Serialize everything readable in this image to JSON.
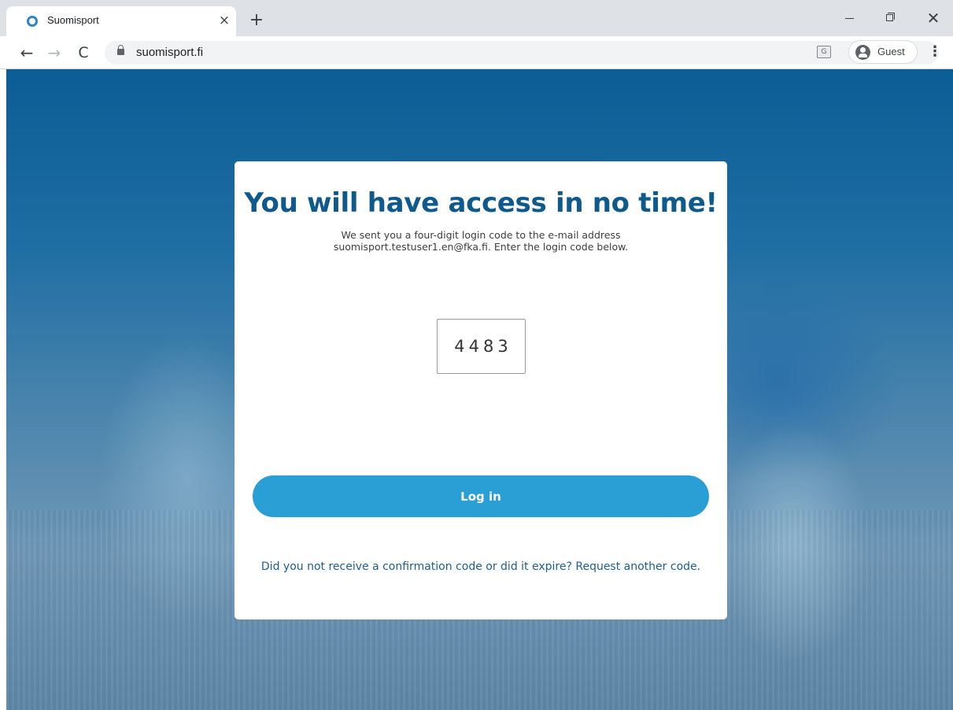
{
  "browser": {
    "tab": {
      "title": "Suomisport",
      "close_glyph": "×"
    },
    "new_tab_glyph": "+",
    "window_controls": {
      "close_glyph": "✕"
    },
    "nav": {
      "back_glyph": "←",
      "forward_glyph": "→",
      "reload_glyph": "C"
    },
    "address": {
      "url": "suomisport.fi"
    },
    "translate_glyph": "G",
    "profile": {
      "label": "Guest"
    },
    "menu_glyph": "⋮",
    "colors": {
      "tabstrip": "#dee1e6",
      "toolbar": "#ffffff",
      "favicon": "#2a86c6"
    },
    "icons": [
      "suomisport-favicon-icon",
      "lock-icon",
      "translate-icon",
      "avatar-icon",
      "kebab-menu-icon"
    ]
  },
  "login": {
    "title": "You will have access in no time!",
    "description": "We sent you a four-digit login code to the e-mail address suomisport.testuser1.en@fka.fi. Enter the login code below.",
    "code_value": "4483",
    "login_button": "Log in",
    "resend_text": "Did you not receive a confirmation code or did it expire? Request another code.",
    "colors": {
      "title": "#0f5a8c",
      "button": "#2a9fd6",
      "link": "#1c5e8f",
      "background": "#1f6ea4"
    }
  }
}
